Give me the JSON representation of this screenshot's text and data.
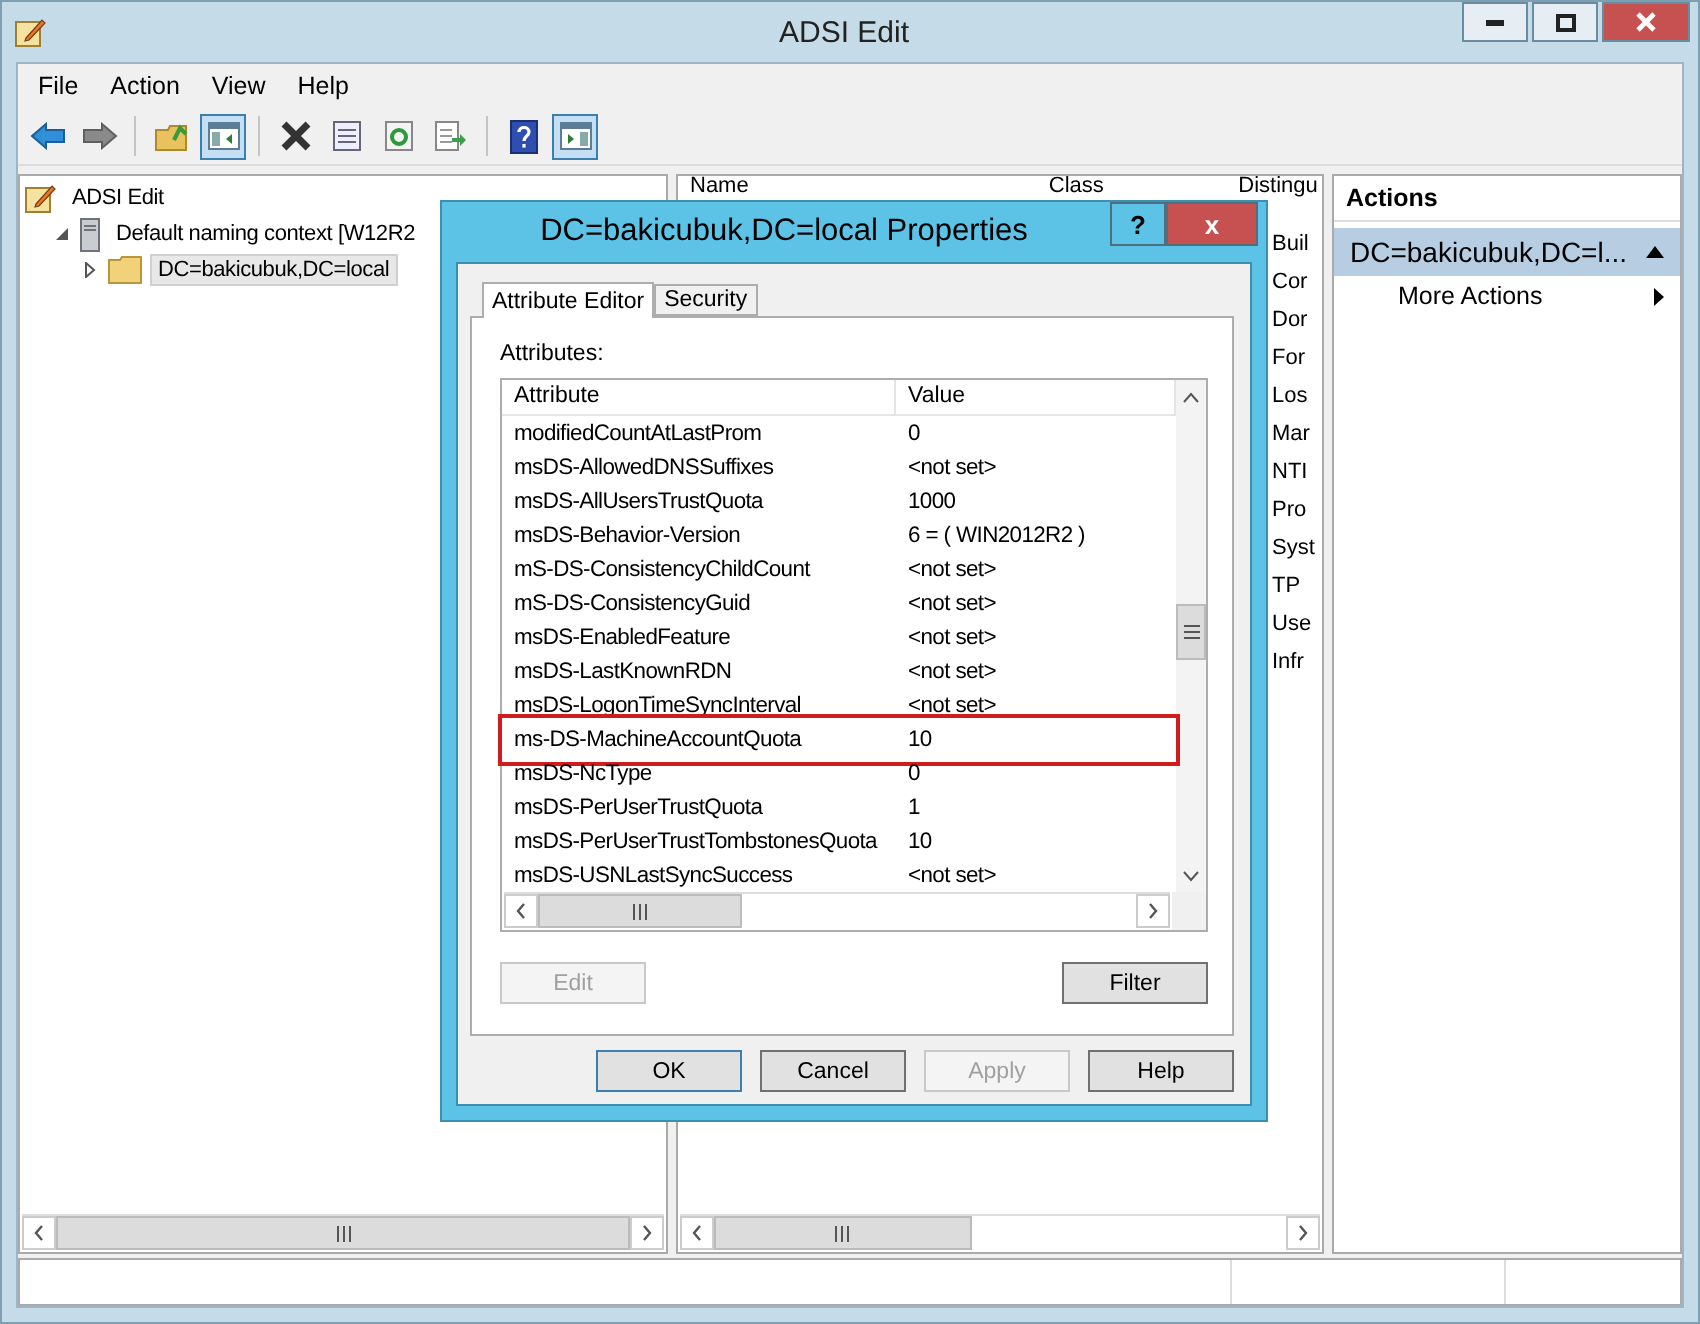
{
  "window": {
    "title": "ADSI Edit"
  },
  "menu": [
    "File",
    "Action",
    "View",
    "Help"
  ],
  "toolbar": [
    {
      "kind": "back",
      "pressed": false
    },
    {
      "kind": "forward",
      "pressed": false
    },
    {
      "kind": "separator"
    },
    {
      "kind": "up-folder",
      "pressed": false
    },
    {
      "kind": "tree-toggle",
      "pressed": true
    },
    {
      "kind": "separator"
    },
    {
      "kind": "delete",
      "pressed": false
    },
    {
      "kind": "properties",
      "pressed": false
    },
    {
      "kind": "refresh",
      "pressed": false
    },
    {
      "kind": "export",
      "pressed": false
    },
    {
      "kind": "separator"
    },
    {
      "kind": "help",
      "pressed": false
    },
    {
      "kind": "action-pane",
      "pressed": true
    }
  ],
  "tree": {
    "label": "ADSI Edit",
    "kind": "app",
    "children": [
      {
        "label": "Default naming context [W12R2",
        "kind": "server",
        "expanded": true,
        "children": [
          {
            "label": "DC=bakicubuk,DC=local",
            "kind": "folder",
            "expanded": false,
            "selected": true
          }
        ]
      }
    ]
  },
  "list": {
    "columns": [
      "Name",
      "Class",
      "Distingu"
    ],
    "rows": [
      "Buil",
      "Cor",
      "Dor",
      "For",
      "Los",
      "Mar",
      "NTI",
      "Pro",
      "Syst",
      "TP",
      "Use",
      "Infr"
    ]
  },
  "actions": {
    "title": "Actions",
    "items": [
      {
        "kind": "section",
        "label": "DC=bakicubuk,DC=l...",
        "selected": true
      },
      {
        "kind": "action",
        "label": "More Actions",
        "selected": false
      }
    ]
  },
  "dialog": {
    "title": "DC=bakicubuk,DC=local Properties",
    "help_glyph": "?",
    "close_glyph": "x",
    "tabs": [
      {
        "label": "Attribute Editor",
        "selected": true
      },
      {
        "label": "Security",
        "selected": false
      }
    ],
    "attributes_label": "Attributes:",
    "columns": [
      "Attribute",
      "Value"
    ],
    "rows": [
      {
        "attribute": "modifiedCountAtLastProm",
        "value": "0",
        "highlighted": false
      },
      {
        "attribute": "msDS-AllowedDNSSuffixes",
        "value": "<not set>",
        "highlighted": false
      },
      {
        "attribute": "msDS-AllUsersTrustQuota",
        "value": "1000",
        "highlighted": false
      },
      {
        "attribute": "msDS-Behavior-Version",
        "value": "6 = ( WIN2012R2 )",
        "highlighted": false
      },
      {
        "attribute": "mS-DS-ConsistencyChildCount",
        "value": "<not set>",
        "highlighted": false
      },
      {
        "attribute": "mS-DS-ConsistencyGuid",
        "value": "<not set>",
        "highlighted": false
      },
      {
        "attribute": "msDS-EnabledFeature",
        "value": "<not set>",
        "highlighted": false
      },
      {
        "attribute": "msDS-LastKnownRDN",
        "value": "<not set>",
        "highlighted": false
      },
      {
        "attribute": "msDS-LogonTimeSyncInterval",
        "value": "<not set>",
        "highlighted": false
      },
      {
        "attribute": "ms-DS-MachineAccountQuota",
        "value": "10",
        "highlighted": true
      },
      {
        "attribute": "msDS-NcType",
        "value": "0",
        "highlighted": false
      },
      {
        "attribute": "msDS-PerUserTrustQuota",
        "value": "1",
        "highlighted": false
      },
      {
        "attribute": "msDS-PerUserTrustTombstonesQuota",
        "value": "10",
        "highlighted": false
      },
      {
        "attribute": "msDS-USNLastSyncSuccess",
        "value": "<not set>",
        "highlighted": false
      }
    ],
    "list_buttons": [
      {
        "label": "Edit",
        "disabled": true
      },
      {
        "label": "Filter",
        "disabled": false
      }
    ],
    "buttons": [
      {
        "label": "OK",
        "disabled": false,
        "default": true
      },
      {
        "label": "Cancel",
        "disabled": false,
        "default": false
      },
      {
        "label": "Apply",
        "disabled": true,
        "default": false
      },
      {
        "label": "Help",
        "disabled": false,
        "default": false
      }
    ]
  }
}
